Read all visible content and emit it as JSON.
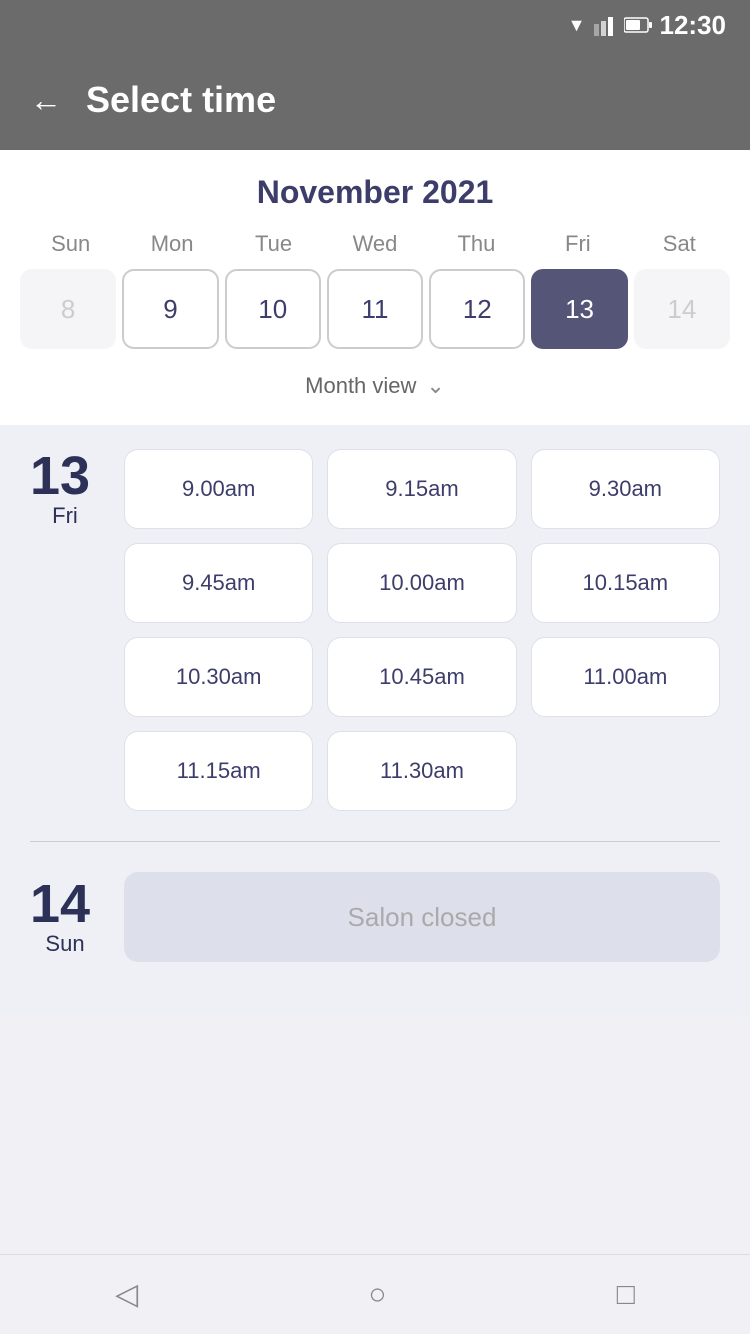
{
  "statusBar": {
    "time": "12:30"
  },
  "header": {
    "back_label": "←",
    "title": "Select time"
  },
  "calendar": {
    "month_title": "November 2021",
    "day_headers": [
      "Sun",
      "Mon",
      "Tue",
      "Wed",
      "Thu",
      "Fri",
      "Sat"
    ],
    "days": [
      {
        "number": "8",
        "state": "inactive"
      },
      {
        "number": "9",
        "state": "bordered"
      },
      {
        "number": "10",
        "state": "bordered"
      },
      {
        "number": "11",
        "state": "bordered"
      },
      {
        "number": "12",
        "state": "bordered"
      },
      {
        "number": "13",
        "state": "selected"
      },
      {
        "number": "14",
        "state": "inactive"
      }
    ],
    "month_view_label": "Month view"
  },
  "day13": {
    "number": "13",
    "name": "Fri",
    "time_slots": [
      "9.00am",
      "9.15am",
      "9.30am",
      "9.45am",
      "10.00am",
      "10.15am",
      "10.30am",
      "10.45am",
      "11.00am",
      "11.15am",
      "11.30am"
    ]
  },
  "day14": {
    "number": "14",
    "name": "Sun",
    "closed_label": "Salon closed"
  },
  "bottomNav": {
    "back_icon": "◁",
    "home_icon": "○",
    "recent_icon": "□"
  }
}
